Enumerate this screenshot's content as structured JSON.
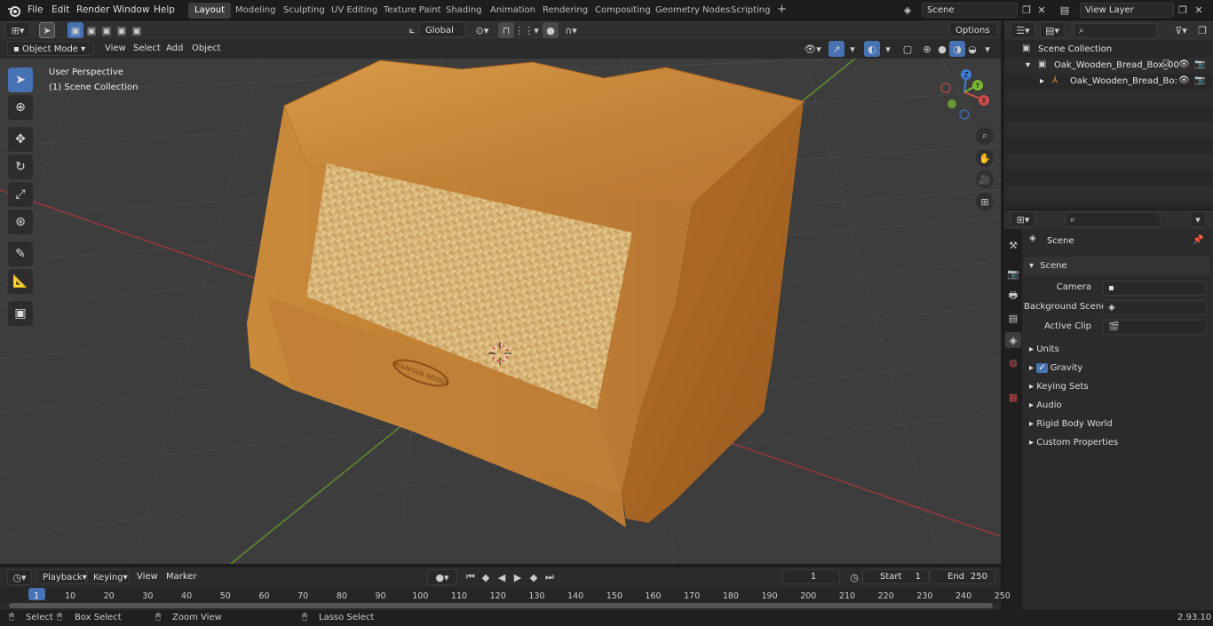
{
  "menus": [
    "File",
    "Edit",
    "Render",
    "Window",
    "Help"
  ],
  "workspaces": [
    "Layout",
    "Modeling",
    "Sculpting",
    "UV Editing",
    "Texture Paint",
    "Shading",
    "Animation",
    "Rendering",
    "Compositing",
    "Geometry Nodes",
    "Scripting"
  ],
  "active_workspace": "Layout",
  "scene_name": "Scene",
  "view_layer": "View Layer",
  "header": {
    "mode": "Object Mode",
    "view": "View",
    "select": "Select",
    "add": "Add",
    "object": "Object",
    "transform": "Global",
    "options": "Options"
  },
  "viewport": {
    "line1": "User Perspective",
    "line2": "(1) Scene Collection",
    "gizmo": {
      "z": "Z",
      "y": "Y",
      "x": "X"
    },
    "logo": "MOUNTAIN WOODS"
  },
  "outliner": {
    "root": "Scene Collection",
    "item1": "Oak_Wooden_Bread_Box_00",
    "item2": "Oak_Wooden_Bread_Bo:"
  },
  "properties": {
    "breadcrumb": "Scene",
    "panel": "Scene",
    "camera_label": "Camera",
    "bg_label": "Background Scene",
    "clip_label": "Active Clip",
    "sections": [
      "Units",
      "Gravity",
      "Keying Sets",
      "Audio",
      "Rigid Body World",
      "Custom Properties"
    ]
  },
  "timeline": {
    "playback": "Playback",
    "keying": "Keying",
    "view": "View",
    "marker": "Marker",
    "frame": "1",
    "start_label": "Start",
    "start": "1",
    "end_label": "End",
    "end": "250",
    "ticks": [
      "1",
      "10",
      "20",
      "30",
      "40",
      "50",
      "60",
      "70",
      "80",
      "90",
      "100",
      "110",
      "120",
      "130",
      "140",
      "150",
      "160",
      "170",
      "180",
      "190",
      "200",
      "210",
      "220",
      "230",
      "240",
      "250"
    ]
  },
  "status": {
    "select": "Select",
    "box": "Box Select",
    "zoom": "Zoom View",
    "lasso": "Lasso Select",
    "version": "2.93.10"
  },
  "colors": {
    "accent": "#4772b3",
    "wood": "#c98a3a",
    "wood_dark": "#9a5d1c"
  }
}
